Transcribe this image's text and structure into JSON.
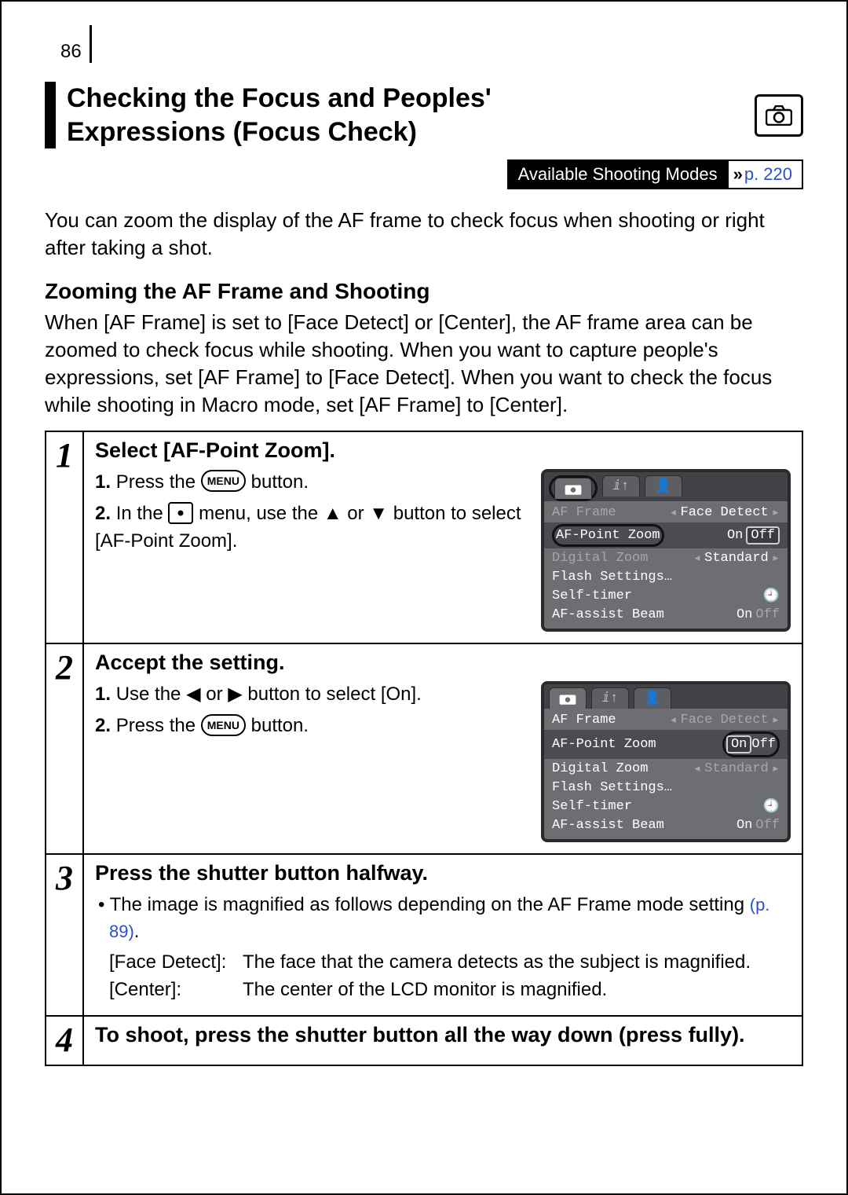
{
  "page_number": "86",
  "title_line1": "Checking the Focus and Peoples'",
  "title_line2": "Expressions (Focus Check)",
  "camera_icon": "camera-rec-icon",
  "modes_label": "Available Shooting Modes",
  "modes_ref": "p. 220",
  "intro": "You can zoom the display of the AF frame to check focus when shooting or right after taking a shot.",
  "subhead": "Zooming the AF Frame and Shooting",
  "subtext": "When [AF Frame] is set to [Face Detect] or [Center], the AF frame area can be zoomed to check focus while shooting. When you want to capture people's expressions, set [AF Frame] to [Face Detect]. When you want to check the focus while shooting in Macro mode, set [AF Frame] to [Center].",
  "steps": {
    "s1": {
      "num": "1",
      "title": "Select [AF-Point Zoom].",
      "l1a": "1.",
      "l1b": "Press the ",
      "l1c": " button.",
      "l2a": "2.",
      "l2b": "In the ",
      "l2c": " menu, use the ",
      "l2d": " or ",
      "l2e": " button to select [AF-Point Zoom].",
      "menu_label": "MENU"
    },
    "s2": {
      "num": "2",
      "title": "Accept the setting.",
      "l1a": "1.",
      "l1b": "Use the ",
      "l1c": " or ",
      "l1d": " button to select [On].",
      "l2a": "2.",
      "l2b": "Press the ",
      "l2c": " button.",
      "menu_label": "MENU"
    },
    "s3": {
      "num": "3",
      "title": "Press the shutter button halfway.",
      "b1a": "• The image is magnified as follows depending on the AF Frame mode setting ",
      "b1link": "(p. 89)",
      "b1b": ".",
      "d1l": "[Face Detect]:",
      "d1v": "The face that the camera detects as the subject is magnified.",
      "d2l": "[Center]:",
      "d2v": "The center of the LCD monitor is magnified."
    },
    "s4": {
      "num": "4",
      "title": "To shoot, press the shutter button all the way down (press fully)."
    }
  },
  "lcd1": {
    "r1l": "AF Frame",
    "r1v": "Face Detect",
    "r2l": "AF-Point Zoom",
    "r2on": "On",
    "r2off": "Off",
    "r3l": "Digital Zoom",
    "r3v": "Standard",
    "r4l": "Flash Settings…",
    "r5l": "Self-timer",
    "r6l": "AF-assist Beam",
    "r6on": "On",
    "r6off": "Off"
  },
  "lcd2": {
    "r1l": "AF Frame",
    "r1v": "Face Detect",
    "r2l": "AF-Point Zoom",
    "r2on": "On",
    "r2off": "Off",
    "r3l": "Digital Zoom",
    "r3v": "Standard",
    "r4l": "Flash Settings…",
    "r5l": "Self-timer",
    "r6l": "AF-assist Beam",
    "r6on": "On",
    "r6off": "Off"
  }
}
